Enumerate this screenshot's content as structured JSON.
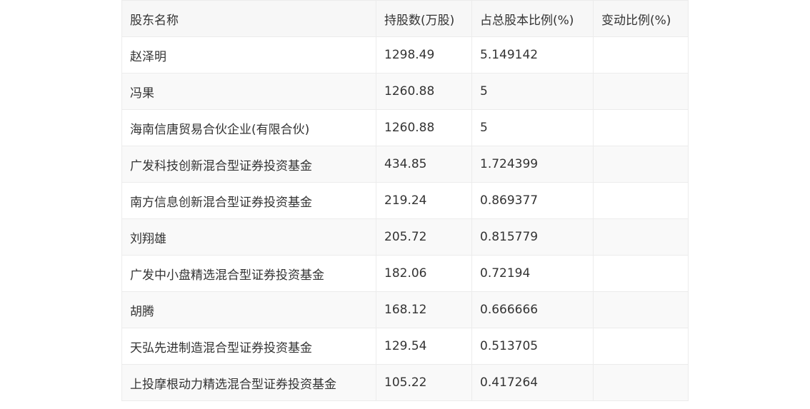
{
  "table": {
    "headers": [
      "股东名称",
      "持股数(万股)",
      "占总股本比例(%)",
      "变动比例(%)"
    ],
    "rows": [
      [
        "赵泽明",
        "1298.49",
        "5.149142",
        ""
      ],
      [
        "冯果",
        "1260.88",
        "5",
        ""
      ],
      [
        "海南信唐贸易合伙企业(有限合伙)",
        "1260.88",
        "5",
        ""
      ],
      [
        "广发科技创新混合型证券投资基金",
        "434.85",
        "1.724399",
        ""
      ],
      [
        "南方信息创新混合型证券投资基金",
        "219.24",
        "0.869377",
        ""
      ],
      [
        "刘翔雄",
        "205.72",
        "0.815779",
        ""
      ],
      [
        "广发中小盘精选混合型证券投资基金",
        "182.06",
        "0.72194",
        ""
      ],
      [
        "胡腾",
        "168.12",
        "0.666666",
        ""
      ],
      [
        "天弘先进制造混合型证券投资基金",
        "129.54",
        "0.513705",
        ""
      ],
      [
        "上投摩根动力精选混合型证券投资基金",
        "105.22",
        "0.417264",
        ""
      ]
    ]
  }
}
